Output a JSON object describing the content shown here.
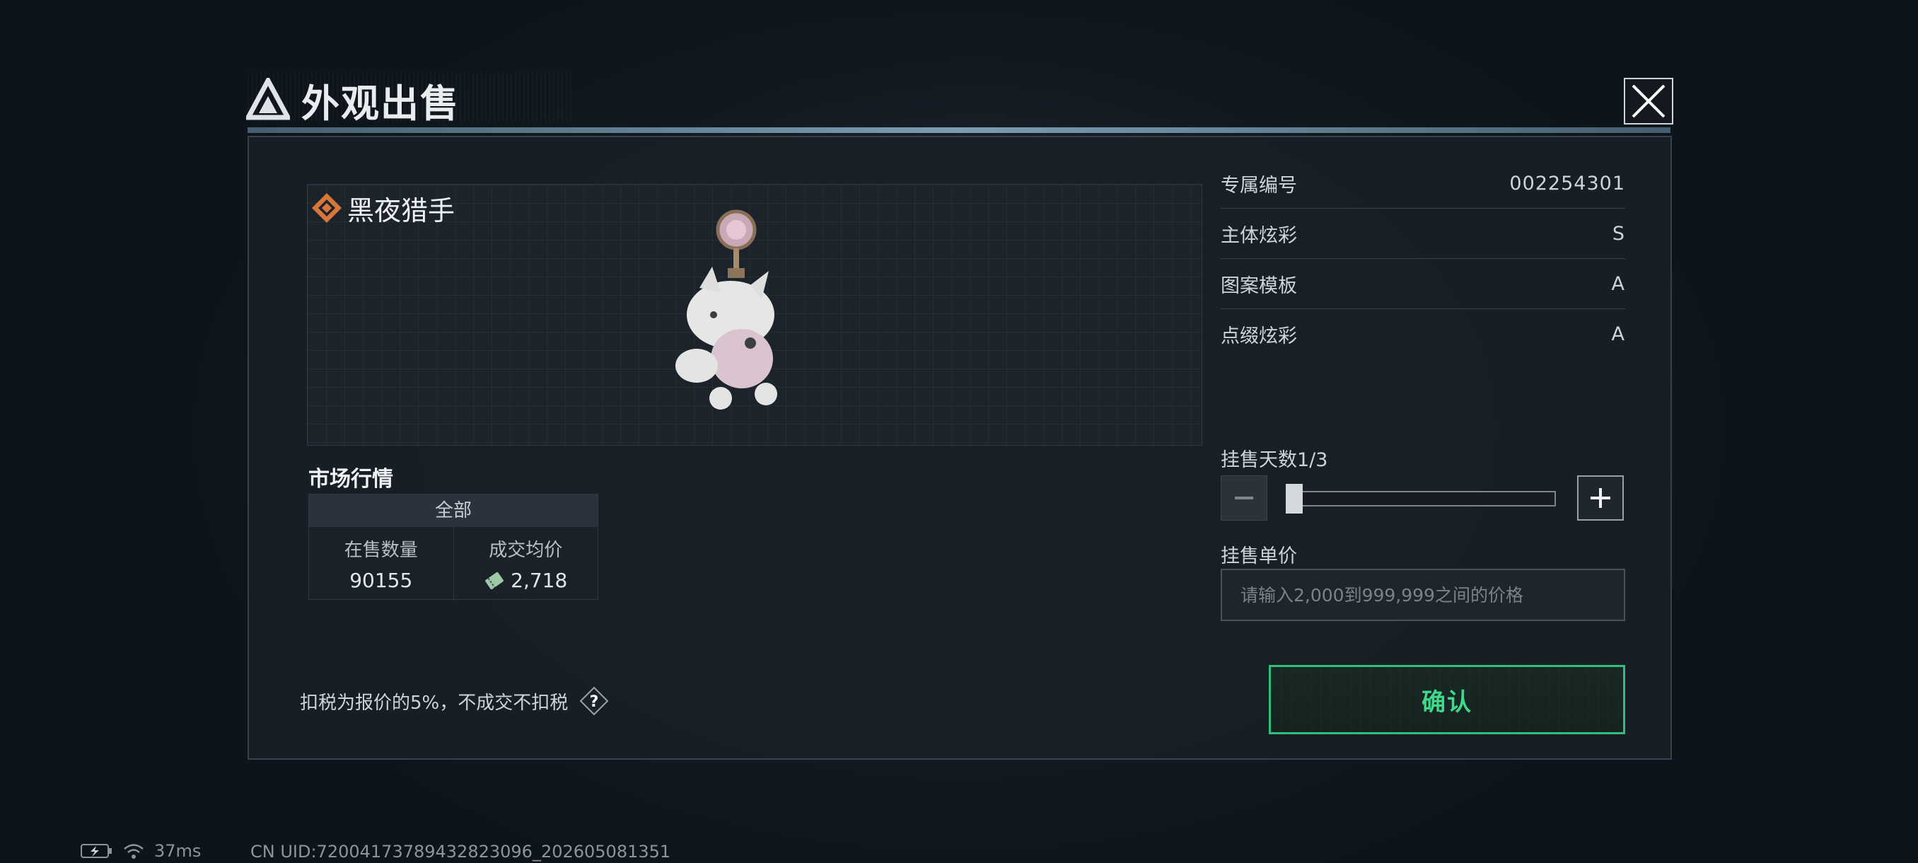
{
  "dialog": {
    "title": "外观出售"
  },
  "item": {
    "name": "黑夜猎手",
    "icon": "diamond-rarity-icon"
  },
  "attributes": [
    {
      "label": "专属编号",
      "value": "002254301"
    },
    {
      "label": "主体炫彩",
      "value": "S"
    },
    {
      "label": "图案模板",
      "value": "A"
    },
    {
      "label": "点缀炫彩",
      "value": "A"
    }
  ],
  "market": {
    "title": "市场行情",
    "tab": "全部",
    "on_sale_label": "在售数量",
    "on_sale_value": "90155",
    "avg_price_label": "成交均价",
    "avg_price_value": "2,718"
  },
  "listing": {
    "days_label": "挂售天数1/3",
    "days_fraction": 0.0,
    "price_label": "挂售单价",
    "price_placeholder": "请输入2,000到999,999之间的价格"
  },
  "footer": {
    "tax_note": "扣税为报价的5%，不成交不扣税",
    "confirm_label": "确认"
  },
  "status": {
    "ping": "37ms",
    "uid": "CN UID:72004173789432823096_202605081351"
  },
  "colors": {
    "accent_green": "#3ed98b",
    "rarity_orange": "#d9773a"
  }
}
